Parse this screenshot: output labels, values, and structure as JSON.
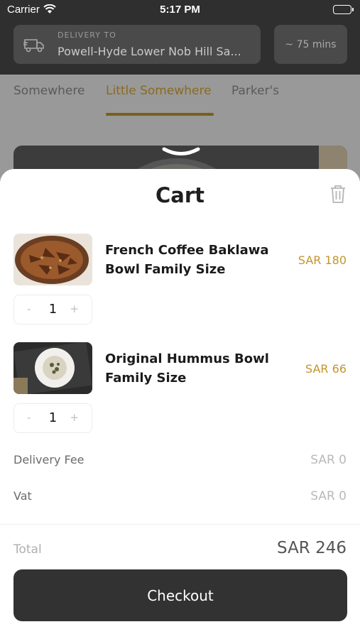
{
  "status_bar": {
    "carrier": "Carrier",
    "time": "5:17 PM"
  },
  "header": {
    "delivery_label": "DELIVERY TO",
    "delivery_address": "Powell-Hyde Lower Nob Hill Sa...",
    "eta": "~ 75 mins"
  },
  "tabs": [
    {
      "label": "Somewhere",
      "active": false
    },
    {
      "label": "Little Somewhere",
      "active": true
    },
    {
      "label": "Parker's",
      "active": false
    }
  ],
  "cart": {
    "title": "Cart",
    "items": [
      {
        "name": "French Coffee Baklawa Bowl Family Size",
        "price": "SAR 180",
        "quantity": "1",
        "minus": "-",
        "plus": "+"
      },
      {
        "name": "Original Hummus Bowl Family Size",
        "price": "SAR 66",
        "quantity": "1",
        "minus": "-",
        "plus": "+"
      }
    ],
    "fees": [
      {
        "label": "Delivery Fee",
        "value": "SAR 0"
      },
      {
        "label": "Vat",
        "value": "SAR 0"
      }
    ],
    "total_label": "Total",
    "total_value": "SAR 246",
    "checkout_label": "Checkout"
  },
  "icons": [
    "wifi-icon",
    "battery-icon",
    "truck-icon",
    "chevron-down-icon",
    "trash-icon"
  ],
  "colors": {
    "accent": "#c4952c",
    "dark": "#323232",
    "sheet_bg": "#ffffff"
  }
}
